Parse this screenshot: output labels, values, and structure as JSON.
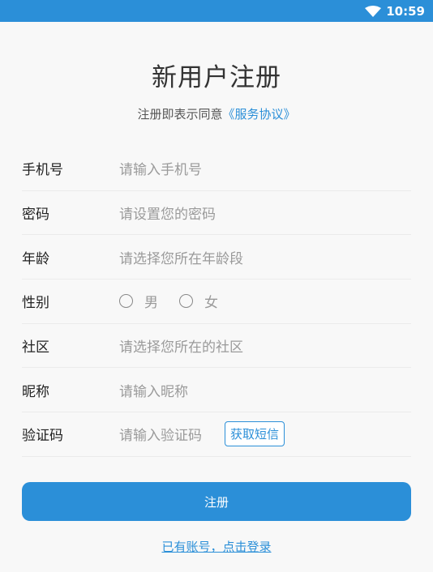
{
  "status_bar": {
    "time": "10:59",
    "wifi_icon": "wifi-icon"
  },
  "page": {
    "title": "新用户注册",
    "agreement_prefix": "注册即表示同意",
    "agreement_link": "《服务协议》"
  },
  "form": {
    "phone": {
      "label": "手机号",
      "placeholder": "请输入手机号"
    },
    "password": {
      "label": "密码",
      "placeholder": "请设置您的密码"
    },
    "age": {
      "label": "年龄",
      "placeholder": "请选择您所在年龄段"
    },
    "gender": {
      "label": "性别",
      "options": [
        "男",
        "女"
      ]
    },
    "community": {
      "label": "社区",
      "placeholder": "请选择您所在的社区"
    },
    "nickname": {
      "label": "昵称",
      "placeholder": "请输入昵称"
    },
    "code": {
      "label": "验证码",
      "placeholder": "请输入验证码",
      "button": "获取短信"
    }
  },
  "actions": {
    "submit": "注册",
    "login_link": "已有账号，点击登录"
  },
  "colors": {
    "accent": "#2b8fd8"
  }
}
